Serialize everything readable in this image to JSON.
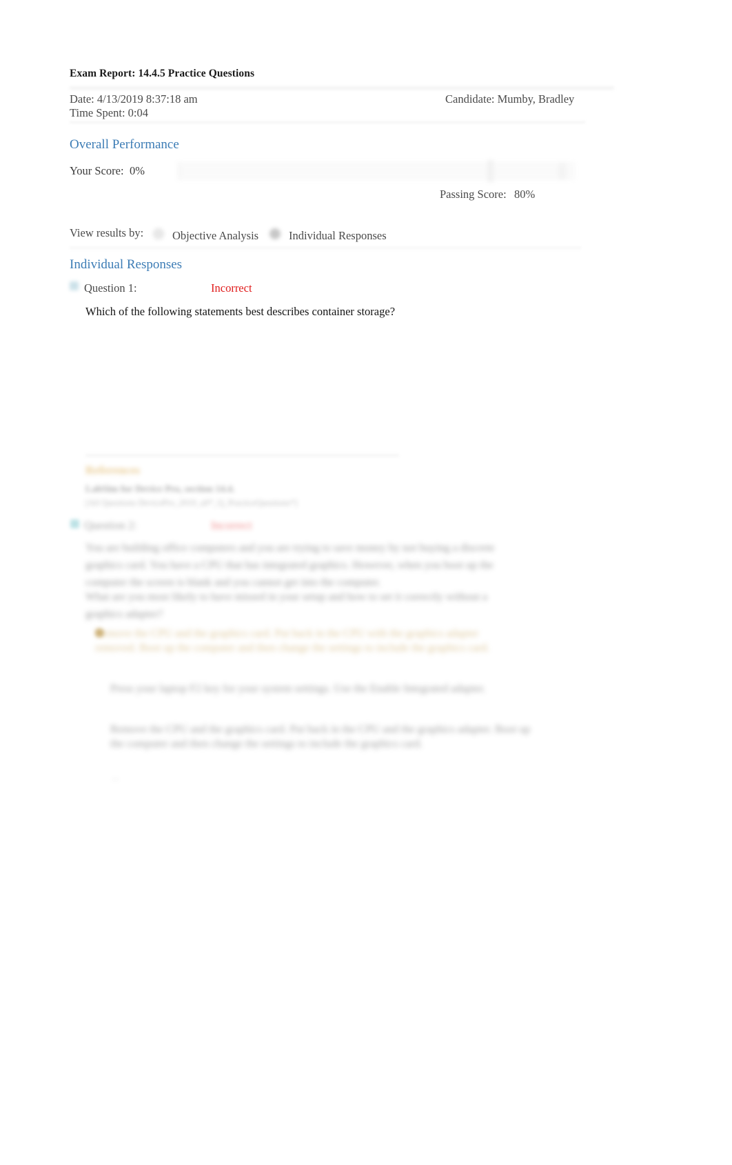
{
  "report": {
    "title": "Exam Report: 14.4.5 Practice Questions",
    "date": "Date: 4/13/2019 8:37:18 am",
    "time_spent": "Time Spent: 0:04",
    "candidate": "Candidate: Mumby, Bradley"
  },
  "overall_performance": {
    "heading": "Overall Performance",
    "your_score_label": "Your Score:",
    "your_score_value": "0%",
    "passing_score_label": "Passing Score:",
    "passing_score_value": "80%",
    "score_percent": 0,
    "passing_percent": 80,
    "accent_color": "#3c7cb5"
  },
  "view_results": {
    "label": "View results by:",
    "options": [
      {
        "label": "Objective Analysis",
        "selected": false
      },
      {
        "label": "Individual Responses",
        "selected": true
      }
    ]
  },
  "individual_responses": {
    "heading": "Individual Responses",
    "questions": [
      {
        "label": "Question 1:",
        "result": "Incorrect",
        "result_color": "#e01b1b",
        "text": "Which of the following statements best describes container storage?"
      },
      {
        "label": "Question 2:",
        "result": "Incorrect",
        "result_color": "#e01b1b",
        "paragraph1": "You are building office computers and you are trying to save money by not buying a discrete graphics card. You have a CPU that has integrated graphics. However, when you boot up the computer the screen is blank and you cannot get into the computer.",
        "paragraph2": "What are you most likely to have missed in your setup and how to set it correctly without a graphics adapter?",
        "options": [
          "Remove the CPU and the graphics card. Put back in the CPU with the graphics adapter removed. Boot up the computer and then change the settings to include the graphics card.",
          "Press your laptop F2 key for your system settings. Use the Enable Integrated adapter.",
          "Remove the CPU and the graphics card. Put back in the CPU and the graphics adapter. Boot up the computer and then change the settings to include the graphics card."
        ],
        "tail": "..."
      }
    ],
    "references": {
      "heading": "References",
      "line1": "LabSim for Device Pro, section 14.4.",
      "line2": "[All Questions DevicePro_2019_all*_Q_PracticeQuestions*]"
    }
  }
}
